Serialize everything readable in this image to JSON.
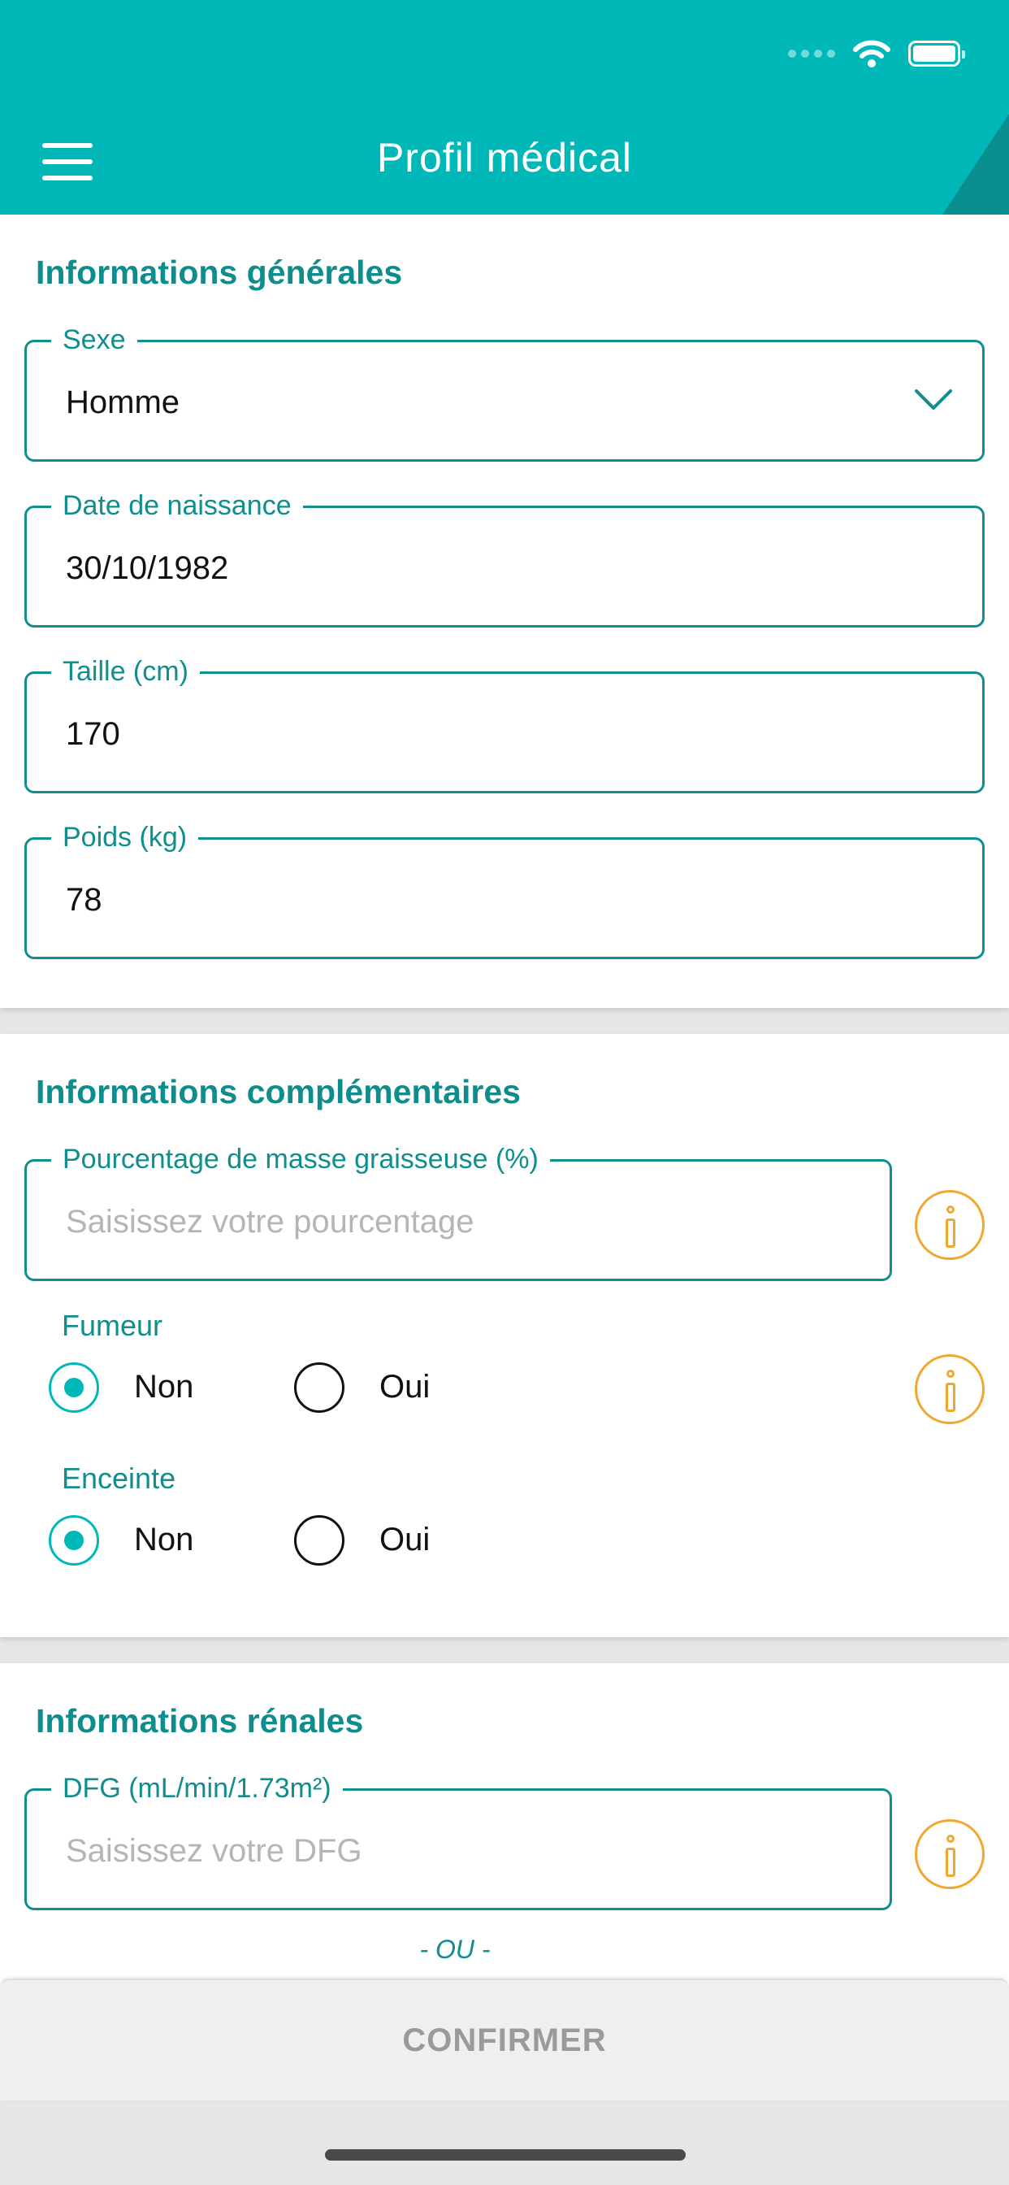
{
  "colors": {
    "header": "#00b8b8",
    "accent": "#108e8e",
    "info": "#f0a830",
    "button_text": "#9a9a9a"
  },
  "header": {
    "title": "Profil médical",
    "menu_icon": "hamburger-menu-icon"
  },
  "status_bar": {
    "icons": [
      "signal-icon",
      "wifi-icon",
      "battery-icon"
    ]
  },
  "general": {
    "title": "Informations générales",
    "sexe": {
      "label": "Sexe",
      "value": "Homme"
    },
    "birth": {
      "label": "Date de naissance",
      "value": "30/10/1982"
    },
    "height": {
      "label": "Taille (cm)",
      "value": "170"
    },
    "weight": {
      "label": "Poids (kg)",
      "value": "78"
    }
  },
  "complementary": {
    "title": "Informations complémentaires",
    "fat": {
      "label": "Pourcentage de masse graisseuse (%)",
      "placeholder": "Saisissez votre pourcentage"
    },
    "smoker": {
      "label": "Fumeur",
      "options": [
        "Non",
        "Oui"
      ],
      "selected": "Non"
    },
    "pregnant": {
      "label": "Enceinte",
      "options": [
        "Non",
        "Oui"
      ],
      "selected": "Non"
    }
  },
  "renal": {
    "title": "Informations rénales",
    "dfg": {
      "label": "DFG (mL/min/1.73m²)",
      "placeholder": "Saisissez votre DFG"
    },
    "or_text": "- OU -"
  },
  "actions": {
    "confirm_label": "CONFIRMER"
  }
}
